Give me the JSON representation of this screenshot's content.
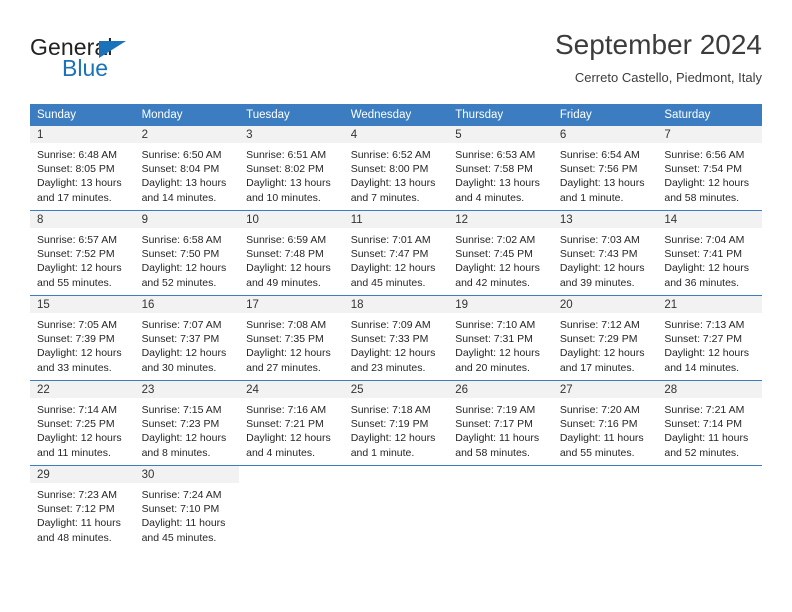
{
  "brand": {
    "name_top": "General",
    "name_bottom": "Blue",
    "accent_color": "#1a72bb",
    "triangle_icon": "brand-triangle-icon"
  },
  "header": {
    "title": "September 2024",
    "subtitle": "Cerreto Castello, Piedmont, Italy"
  },
  "theme": {
    "header_blue": "#3b7dc0",
    "date_band_gray": "#f2f2f2",
    "text_color": "#262626"
  },
  "weekdays": [
    "Sunday",
    "Monday",
    "Tuesday",
    "Wednesday",
    "Thursday",
    "Friday",
    "Saturday"
  ],
  "weeks": [
    [
      {
        "date": "1",
        "sunrise": "Sunrise: 6:48 AM",
        "sunset": "Sunset: 8:05 PM",
        "daylight1": "Daylight: 13 hours",
        "daylight2": "and 17 minutes."
      },
      {
        "date": "2",
        "sunrise": "Sunrise: 6:50 AM",
        "sunset": "Sunset: 8:04 PM",
        "daylight1": "Daylight: 13 hours",
        "daylight2": "and 14 minutes."
      },
      {
        "date": "3",
        "sunrise": "Sunrise: 6:51 AM",
        "sunset": "Sunset: 8:02 PM",
        "daylight1": "Daylight: 13 hours",
        "daylight2": "and 10 minutes."
      },
      {
        "date": "4",
        "sunrise": "Sunrise: 6:52 AM",
        "sunset": "Sunset: 8:00 PM",
        "daylight1": "Daylight: 13 hours",
        "daylight2": "and 7 minutes."
      },
      {
        "date": "5",
        "sunrise": "Sunrise: 6:53 AM",
        "sunset": "Sunset: 7:58 PM",
        "daylight1": "Daylight: 13 hours",
        "daylight2": "and 4 minutes."
      },
      {
        "date": "6",
        "sunrise": "Sunrise: 6:54 AM",
        "sunset": "Sunset: 7:56 PM",
        "daylight1": "Daylight: 13 hours",
        "daylight2": "and 1 minute."
      },
      {
        "date": "7",
        "sunrise": "Sunrise: 6:56 AM",
        "sunset": "Sunset: 7:54 PM",
        "daylight1": "Daylight: 12 hours",
        "daylight2": "and 58 minutes."
      }
    ],
    [
      {
        "date": "8",
        "sunrise": "Sunrise: 6:57 AM",
        "sunset": "Sunset: 7:52 PM",
        "daylight1": "Daylight: 12 hours",
        "daylight2": "and 55 minutes."
      },
      {
        "date": "9",
        "sunrise": "Sunrise: 6:58 AM",
        "sunset": "Sunset: 7:50 PM",
        "daylight1": "Daylight: 12 hours",
        "daylight2": "and 52 minutes."
      },
      {
        "date": "10",
        "sunrise": "Sunrise: 6:59 AM",
        "sunset": "Sunset: 7:48 PM",
        "daylight1": "Daylight: 12 hours",
        "daylight2": "and 49 minutes."
      },
      {
        "date": "11",
        "sunrise": "Sunrise: 7:01 AM",
        "sunset": "Sunset: 7:47 PM",
        "daylight1": "Daylight: 12 hours",
        "daylight2": "and 45 minutes."
      },
      {
        "date": "12",
        "sunrise": "Sunrise: 7:02 AM",
        "sunset": "Sunset: 7:45 PM",
        "daylight1": "Daylight: 12 hours",
        "daylight2": "and 42 minutes."
      },
      {
        "date": "13",
        "sunrise": "Sunrise: 7:03 AM",
        "sunset": "Sunset: 7:43 PM",
        "daylight1": "Daylight: 12 hours",
        "daylight2": "and 39 minutes."
      },
      {
        "date": "14",
        "sunrise": "Sunrise: 7:04 AM",
        "sunset": "Sunset: 7:41 PM",
        "daylight1": "Daylight: 12 hours",
        "daylight2": "and 36 minutes."
      }
    ],
    [
      {
        "date": "15",
        "sunrise": "Sunrise: 7:05 AM",
        "sunset": "Sunset: 7:39 PM",
        "daylight1": "Daylight: 12 hours",
        "daylight2": "and 33 minutes."
      },
      {
        "date": "16",
        "sunrise": "Sunrise: 7:07 AM",
        "sunset": "Sunset: 7:37 PM",
        "daylight1": "Daylight: 12 hours",
        "daylight2": "and 30 minutes."
      },
      {
        "date": "17",
        "sunrise": "Sunrise: 7:08 AM",
        "sunset": "Sunset: 7:35 PM",
        "daylight1": "Daylight: 12 hours",
        "daylight2": "and 27 minutes."
      },
      {
        "date": "18",
        "sunrise": "Sunrise: 7:09 AM",
        "sunset": "Sunset: 7:33 PM",
        "daylight1": "Daylight: 12 hours",
        "daylight2": "and 23 minutes."
      },
      {
        "date": "19",
        "sunrise": "Sunrise: 7:10 AM",
        "sunset": "Sunset: 7:31 PM",
        "daylight1": "Daylight: 12 hours",
        "daylight2": "and 20 minutes."
      },
      {
        "date": "20",
        "sunrise": "Sunrise: 7:12 AM",
        "sunset": "Sunset: 7:29 PM",
        "daylight1": "Daylight: 12 hours",
        "daylight2": "and 17 minutes."
      },
      {
        "date": "21",
        "sunrise": "Sunrise: 7:13 AM",
        "sunset": "Sunset: 7:27 PM",
        "daylight1": "Daylight: 12 hours",
        "daylight2": "and 14 minutes."
      }
    ],
    [
      {
        "date": "22",
        "sunrise": "Sunrise: 7:14 AM",
        "sunset": "Sunset: 7:25 PM",
        "daylight1": "Daylight: 12 hours",
        "daylight2": "and 11 minutes."
      },
      {
        "date": "23",
        "sunrise": "Sunrise: 7:15 AM",
        "sunset": "Sunset: 7:23 PM",
        "daylight1": "Daylight: 12 hours",
        "daylight2": "and 8 minutes."
      },
      {
        "date": "24",
        "sunrise": "Sunrise: 7:16 AM",
        "sunset": "Sunset: 7:21 PM",
        "daylight1": "Daylight: 12 hours",
        "daylight2": "and 4 minutes."
      },
      {
        "date": "25",
        "sunrise": "Sunrise: 7:18 AM",
        "sunset": "Sunset: 7:19 PM",
        "daylight1": "Daylight: 12 hours",
        "daylight2": "and 1 minute."
      },
      {
        "date": "26",
        "sunrise": "Sunrise: 7:19 AM",
        "sunset": "Sunset: 7:17 PM",
        "daylight1": "Daylight: 11 hours",
        "daylight2": "and 58 minutes."
      },
      {
        "date": "27",
        "sunrise": "Sunrise: 7:20 AM",
        "sunset": "Sunset: 7:16 PM",
        "daylight1": "Daylight: 11 hours",
        "daylight2": "and 55 minutes."
      },
      {
        "date": "28",
        "sunrise": "Sunrise: 7:21 AM",
        "sunset": "Sunset: 7:14 PM",
        "daylight1": "Daylight: 11 hours",
        "daylight2": "and 52 minutes."
      }
    ],
    [
      {
        "date": "29",
        "sunrise": "Sunrise: 7:23 AM",
        "sunset": "Sunset: 7:12 PM",
        "daylight1": "Daylight: 11 hours",
        "daylight2": "and 48 minutes."
      },
      {
        "date": "30",
        "sunrise": "Sunrise: 7:24 AM",
        "sunset": "Sunset: 7:10 PM",
        "daylight1": "Daylight: 11 hours",
        "daylight2": "and 45 minutes."
      },
      null,
      null,
      null,
      null,
      null
    ]
  ]
}
